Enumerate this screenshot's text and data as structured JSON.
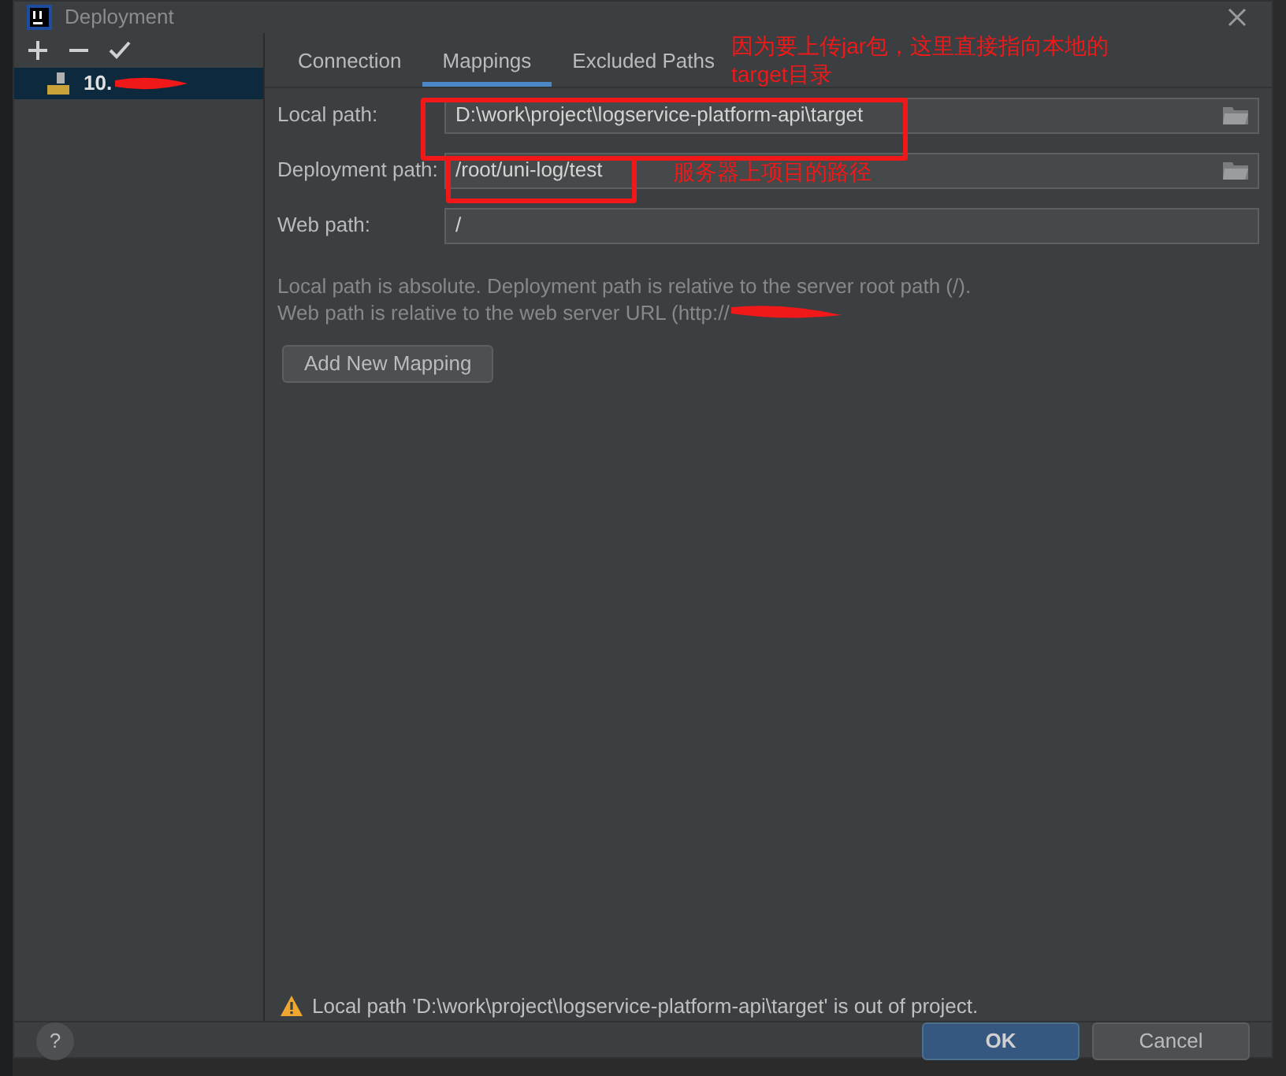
{
  "window": {
    "title": "Deployment"
  },
  "toolbar": [
    {
      "kind": "add"
    },
    {
      "kind": "remove"
    },
    {
      "kind": "check"
    }
  ],
  "servers": [
    {
      "name": "10.",
      "selected": true
    }
  ],
  "tabs": [
    {
      "label": "Connection",
      "selected": false
    },
    {
      "label": "Mappings",
      "selected": true
    },
    {
      "label": "Excluded Paths",
      "selected": false
    }
  ],
  "fields": [
    {
      "label": "Local path:",
      "value": "D:\\work\\project\\logservice-platform-api\\target",
      "browse": true
    },
    {
      "label": "Deployment path:",
      "value": "/root/uni-log/test",
      "browse": true
    },
    {
      "label": "Web path:",
      "value": "/",
      "browse": false
    }
  ],
  "hints": [
    "Local path is absolute. Deployment path is relative to the server root path (/).",
    "Web path is relative to the web server URL (http://"
  ],
  "add_mapping_button": "Add New Mapping",
  "warning": "Local path 'D:\\work\\project\\logservice-platform-api\\target' is out of project.",
  "help_button": "?",
  "buttons": [
    {
      "label": "OK",
      "primary": true
    },
    {
      "label": "Cancel",
      "primary": false
    }
  ],
  "annotations": [
    "因为要上传jar包，这里直接指向本地的",
    "target目录",
    "服务器上项目的路径"
  ]
}
